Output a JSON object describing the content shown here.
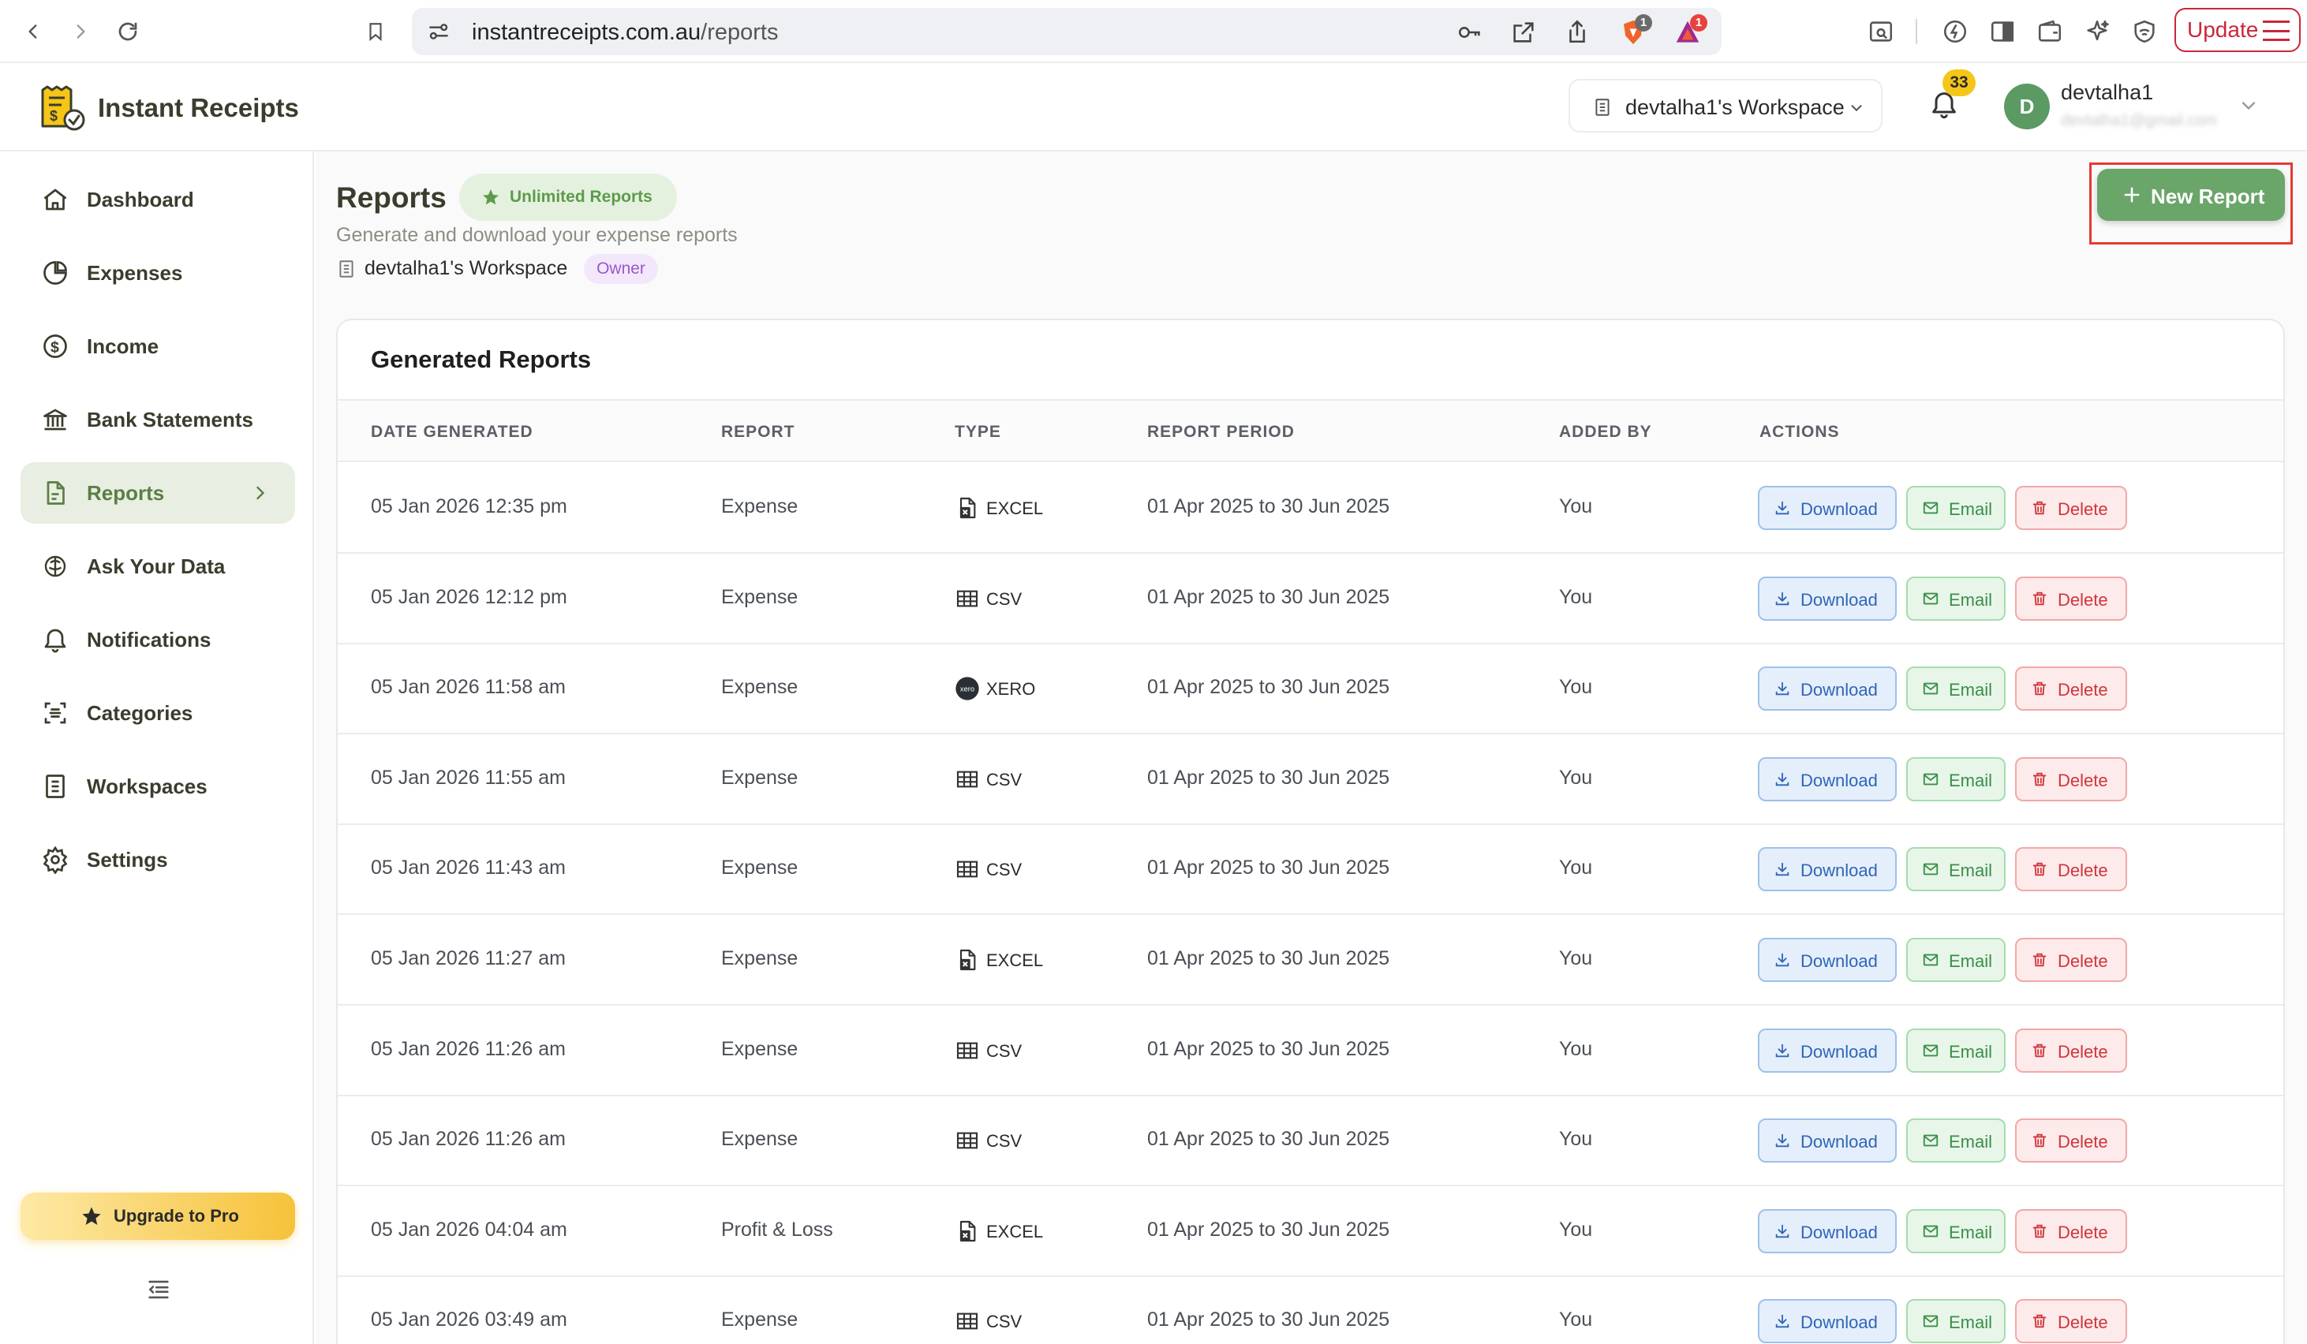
{
  "browser": {
    "url_host": "instantreceipts.com.au",
    "url_path": "/reports",
    "ext_badge_1": "1",
    "ext_badge_2": "1",
    "update_label": "Update"
  },
  "header": {
    "brand": "Instant Receipts",
    "workspace": "devtalha1's Workspace",
    "notification_count": "33",
    "avatar_initial": "D",
    "user_name": "devtalha1",
    "user_email": "devtalha1@gmail.com"
  },
  "sidebar": {
    "items": [
      {
        "label": "Dashboard",
        "icon": "home-icon"
      },
      {
        "label": "Expenses",
        "icon": "pie-chart-icon"
      },
      {
        "label": "Income",
        "icon": "dollar-circle-icon"
      },
      {
        "label": "Bank Statements",
        "icon": "bank-icon"
      },
      {
        "label": "Reports",
        "icon": "file-report-icon",
        "active": true
      },
      {
        "label": "Ask Your Data",
        "icon": "ai-chat-icon"
      },
      {
        "label": "Notifications",
        "icon": "bell-icon"
      },
      {
        "label": "Categories",
        "icon": "categories-icon"
      },
      {
        "label": "Workspaces",
        "icon": "building-icon"
      },
      {
        "label": "Settings",
        "icon": "gear-icon"
      }
    ],
    "upgrade_label": "Upgrade to Pro"
  },
  "page": {
    "title": "Reports",
    "badge": "Unlimited Reports",
    "subtitle": "Generate and download your expense reports",
    "workspace": "devtalha1's Workspace",
    "role": "Owner",
    "new_report_label": "New Report"
  },
  "table": {
    "title": "Generated Reports",
    "columns": [
      "DATE GENERATED",
      "REPORT",
      "TYPE",
      "REPORT PERIOD",
      "ADDED BY",
      "ACTIONS"
    ],
    "actions": {
      "download": "Download",
      "email": "Email",
      "delete": "Delete"
    },
    "rows": [
      {
        "date": "05 Jan 2026 12:35 pm",
        "report": "Expense",
        "type": "EXCEL",
        "type_icon": "excel-icon",
        "period": "01 Apr 2025 to 30 Jun 2025",
        "added_by": "You"
      },
      {
        "date": "05 Jan 2026 12:12 pm",
        "report": "Expense",
        "type": "CSV",
        "type_icon": "csv-table-icon",
        "period": "01 Apr 2025 to 30 Jun 2025",
        "added_by": "You"
      },
      {
        "date": "05 Jan 2026 11:58 am",
        "report": "Expense",
        "type": "XERO",
        "type_icon": "xero-icon",
        "period": "01 Apr 2025 to 30 Jun 2025",
        "added_by": "You"
      },
      {
        "date": "05 Jan 2026 11:55 am",
        "report": "Expense",
        "type": "CSV",
        "type_icon": "csv-table-icon",
        "period": "01 Apr 2025 to 30 Jun 2025",
        "added_by": "You"
      },
      {
        "date": "05 Jan 2026 11:43 am",
        "report": "Expense",
        "type": "CSV",
        "type_icon": "csv-table-icon",
        "period": "01 Apr 2025 to 30 Jun 2025",
        "added_by": "You"
      },
      {
        "date": "05 Jan 2026 11:27 am",
        "report": "Expense",
        "type": "EXCEL",
        "type_icon": "excel-icon",
        "period": "01 Apr 2025 to 30 Jun 2025",
        "added_by": "You"
      },
      {
        "date": "05 Jan 2026 11:26 am",
        "report": "Expense",
        "type": "CSV",
        "type_icon": "csv-table-icon",
        "period": "01 Apr 2025 to 30 Jun 2025",
        "added_by": "You"
      },
      {
        "date": "05 Jan 2026 11:26 am",
        "report": "Expense",
        "type": "CSV",
        "type_icon": "csv-table-icon",
        "period": "01 Apr 2025 to 30 Jun 2025",
        "added_by": "You"
      },
      {
        "date": "05 Jan 2026 04:04 am",
        "report": "Profit & Loss",
        "type": "EXCEL",
        "type_icon": "excel-icon",
        "period": "01 Apr 2025 to 30 Jun 2025",
        "added_by": "You"
      },
      {
        "date": "05 Jan 2026 03:49 am",
        "report": "Expense",
        "type": "CSV",
        "type_icon": "csv-table-icon",
        "period": "01 Apr 2025 to 30 Jun 2025",
        "added_by": "You"
      }
    ]
  },
  "colors": {
    "brand_text": "#3a3d2d",
    "primary_green": "#6aa56a",
    "active_nav_bg": "#e8eee2",
    "highlight_red": "#e53935",
    "download_blue": "#2f65b8",
    "email_green": "#3c8e48",
    "delete_red": "#d0343a"
  }
}
